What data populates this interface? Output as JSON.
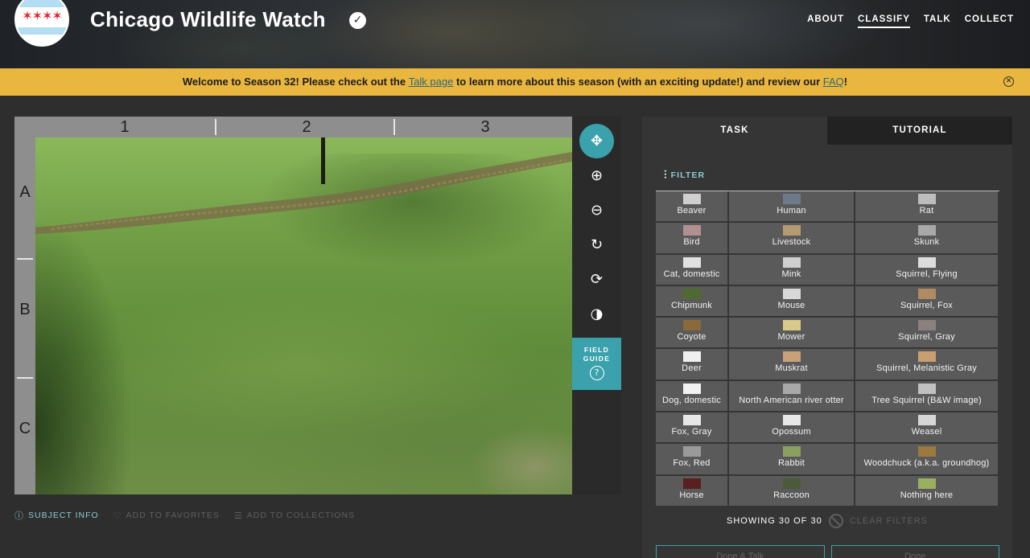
{
  "header": {
    "title": "Chicago Wildlife Watch",
    "nav": [
      {
        "label": "ABOUT",
        "active": false
      },
      {
        "label": "CLASSIFY",
        "active": true
      },
      {
        "label": "TALK",
        "active": false
      },
      {
        "label": "COLLECT",
        "active": false
      }
    ]
  },
  "announcement": {
    "text_1": "Welcome to Season 32! Please check out the ",
    "link_1": "Talk page",
    "text_2": " to learn more about this season (with an exciting update!) and review our ",
    "link_2": "FAQ",
    "text_3": "!"
  },
  "viewer": {
    "columns": [
      "1",
      "2",
      "3"
    ],
    "rows": [
      "A",
      "B",
      "C"
    ],
    "tools": [
      "move-icon",
      "zoom-in-icon",
      "zoom-out-icon",
      "rotate-icon",
      "reset-icon",
      "invert-icon"
    ],
    "field_guide_label": "FIELD GUIDE",
    "field_guide_icon": "?"
  },
  "meta_bar": {
    "subject_info": "SUBJECT INFO",
    "add_favorites": "ADD TO FAVORITES",
    "add_collections": "ADD TO COLLECTIONS"
  },
  "panel": {
    "tabs": [
      "TASK",
      "TUTORIAL"
    ],
    "filter_label": "FILTER",
    "choices": [
      {
        "label": "Beaver",
        "color": "#cfcfcf"
      },
      {
        "label": "Human",
        "color": "#6e7a8a"
      },
      {
        "label": "Rat",
        "color": "#bdbdbd"
      },
      {
        "label": "Bird",
        "color": "#b09090"
      },
      {
        "label": "Livestock",
        "color": "#b39a70"
      },
      {
        "label": "Skunk",
        "color": "#a8a8a8"
      },
      {
        "label": "Cat, domestic",
        "color": "#e0e0e0"
      },
      {
        "label": "Mink",
        "color": "#cfcfcf"
      },
      {
        "label": "Squirrel, Flying",
        "color": "#dcdcdc"
      },
      {
        "label": "Chipmunk",
        "color": "#4f6a30"
      },
      {
        "label": "Mouse",
        "color": "#d8d8d8"
      },
      {
        "label": "Squirrel, Fox",
        "color": "#b08a60"
      },
      {
        "label": "Coyote",
        "color": "#8a6a3a"
      },
      {
        "label": "Mower",
        "color": "#d9c98a"
      },
      {
        "label": "Squirrel, Gray",
        "color": "#8a8080"
      },
      {
        "label": "Deer",
        "color": "#f0f0f0"
      },
      {
        "label": "Muskrat",
        "color": "#c9a077"
      },
      {
        "label": "Squirrel, Melanistic Gray",
        "color": "#c8a070"
      },
      {
        "label": "Dog, domestic",
        "color": "#f2f2f2"
      },
      {
        "label": "North American river otter",
        "color": "#a8a8a8"
      },
      {
        "label": "Tree Squirrel (B&W image)",
        "color": "#c0c0c0"
      },
      {
        "label": "Fox, Gray",
        "color": "#e6e6e6"
      },
      {
        "label": "Opossum",
        "color": "#e8e8e8"
      },
      {
        "label": "Weasel",
        "color": "#d6d6d6"
      },
      {
        "label": "Fox, Red",
        "color": "#9a9a9a"
      },
      {
        "label": "Rabbit",
        "color": "#8aa060"
      },
      {
        "label": "Woodchuck (a.k.a. groundhog)",
        "color": "#9a7a40"
      },
      {
        "label": "Horse",
        "color": "#5a2020"
      },
      {
        "label": "Raccoon",
        "color": "#4a5a3a"
      },
      {
        "label": "Nothing here",
        "color": "#9ab060"
      }
    ],
    "showing": "SHOWING 30 OF 30",
    "clear_filters": "CLEAR FILTERS",
    "buttons": [
      "Done & Talk",
      "Done"
    ]
  }
}
